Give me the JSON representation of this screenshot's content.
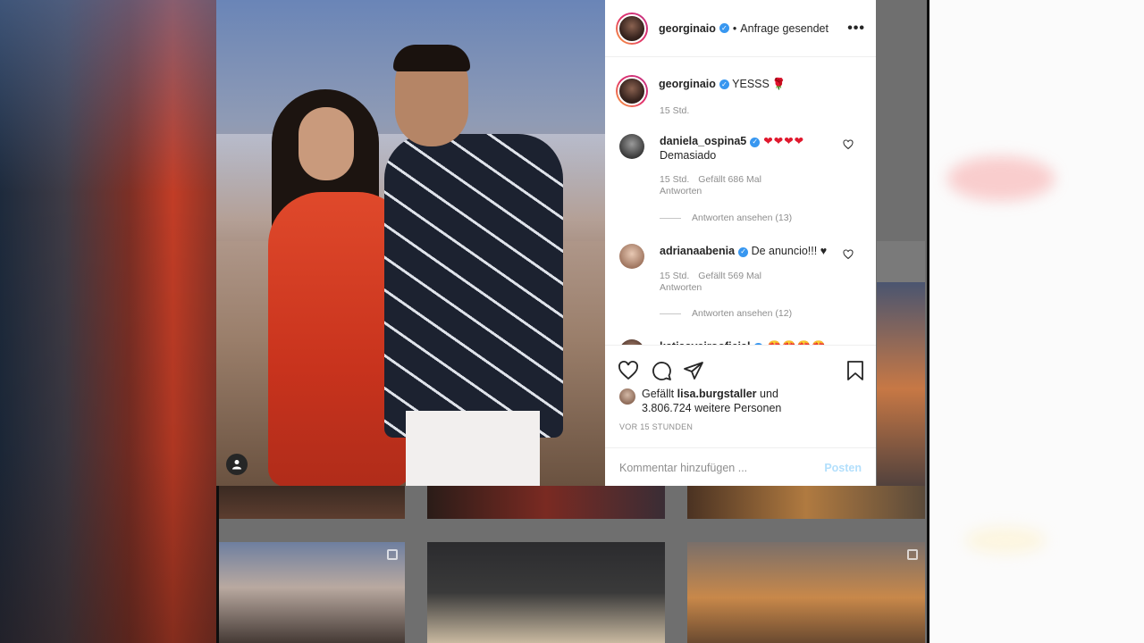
{
  "post": {
    "author": "georginaio",
    "follow_status": "Anfrage gesendet",
    "follow_prefix": "•",
    "more_label": "•••"
  },
  "caption": {
    "username": "georginaio",
    "text": "YESSS",
    "time": "15 Std."
  },
  "comments": [
    {
      "username": "daniela_ospina5",
      "text": "Demasiado",
      "emoji": "❤❤❤❤",
      "time": "15 Std.",
      "likes": "Gefällt 686 Mal",
      "reply_label": "Antworten",
      "view_replies": "Antworten ansehen (13)"
    },
    {
      "username": "adrianaabenia",
      "text": "De anuncio!!! ♥",
      "time": "15 Std.",
      "likes": "Gefällt 569 Mal",
      "reply_label": "Antworten",
      "view_replies": "Antworten ansehen (12)"
    },
    {
      "username": "katiaaveirooficial",
      "emoji": "😍😍😍😍"
    }
  ],
  "likes": {
    "prefix": "Gefällt",
    "user": "lisa.burgstaller",
    "conj": "und",
    "others": "3.806.724 weitere Personen"
  },
  "post_time": "VOR 15 STUNDEN",
  "comment_input": {
    "placeholder": "Kommentar hinzufügen ...",
    "post_label": "Posten"
  },
  "icons": {
    "like": "heart-outline-icon",
    "comment": "speech-bubble-icon",
    "share": "paper-plane-icon",
    "save": "bookmark-icon",
    "more": "ellipsis-icon",
    "tag": "person-tag-icon",
    "verified": "verified-badge-icon"
  },
  "colors": {
    "verified": "#3897f0",
    "post_button_disabled": "#b2dffc",
    "secondary_text": "#8e8e8e",
    "text": "#262626"
  }
}
